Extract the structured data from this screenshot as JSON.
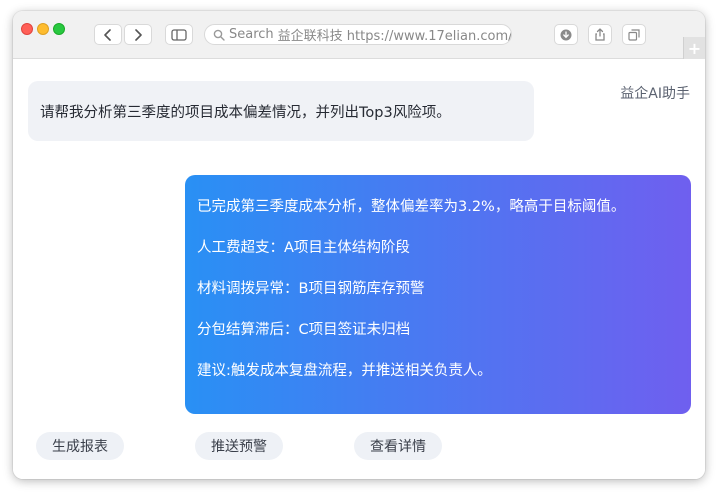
{
  "browser": {
    "url_prefix": "Search",
    "url_text": "益企联科技 https://www.17elian.com/",
    "new_tab_label": "+"
  },
  "chat": {
    "assistant_name": "益企AI助手",
    "user_message": "请帮我分析第三季度的项目成本偏差情况，并列出Top3风险项。",
    "reply_lines": [
      "已完成第三季度成本分析，整体偏差率为3.2%，略高于目标阈值。",
      "人工费超支：A项目主体结构阶段",
      "材料调拨异常：B项目钢筋库存预警",
      "分包结算滞后：C项目签证未归档",
      "建议:触发成本复盘流程，并推送相关负责人。"
    ]
  },
  "actions": {
    "report": "生成报表",
    "push": "推送预警",
    "detail": "查看详情"
  },
  "colors": {
    "reply_gradient_start": "#2990f4",
    "reply_gradient_end": "#6f5fef",
    "user_bubble": "#f0f2f6"
  }
}
